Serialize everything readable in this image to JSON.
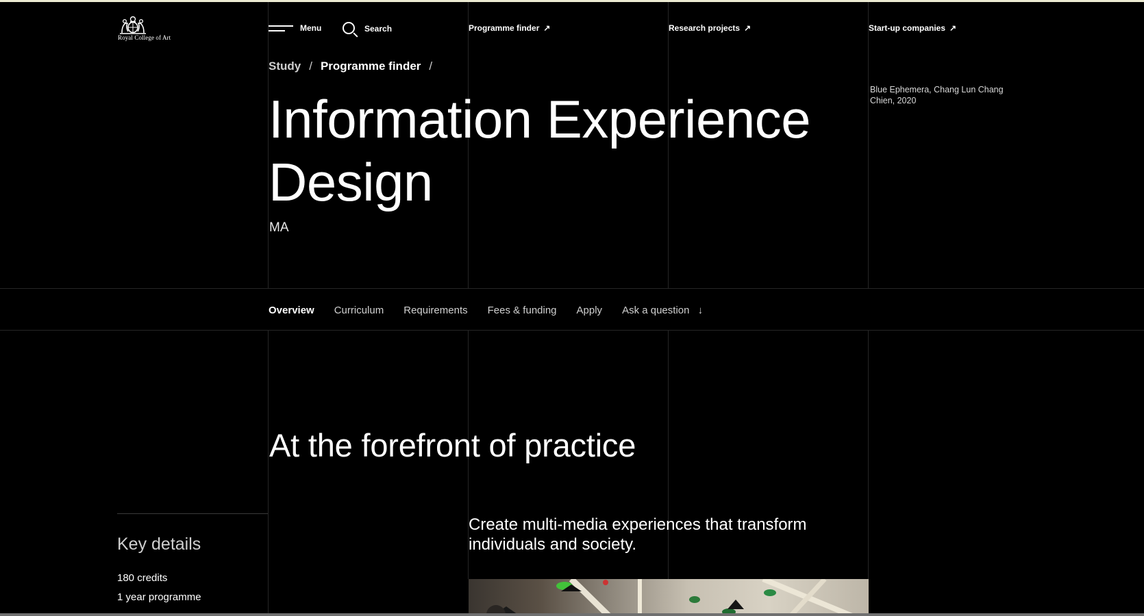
{
  "logo": {
    "text": "Royal College of Art"
  },
  "header": {
    "menu_label": "Menu",
    "search_label": "Search",
    "links": [
      {
        "label": "Programme finder",
        "icon": "external-arrow-icon"
      },
      {
        "label": "Research projects",
        "icon": "external-arrow-icon"
      },
      {
        "label": "Start-up companies",
        "icon": "external-arrow-icon"
      }
    ]
  },
  "breadcrumb": {
    "items": [
      "Study",
      "Programme finder"
    ],
    "separator": "/"
  },
  "hero": {
    "title": "Information Experience Design",
    "degree": "MA",
    "caption": "Blue Ephemera, Chang Lun Chang Chien, 2020"
  },
  "tabs": [
    {
      "label": "Overview",
      "active": true
    },
    {
      "label": "Curriculum"
    },
    {
      "label": "Requirements"
    },
    {
      "label": "Fees & funding"
    },
    {
      "label": "Apply"
    },
    {
      "label": "Ask a question",
      "icon": "arrow-down-icon"
    }
  ],
  "overview": {
    "heading": "At the forefront of practice",
    "intro": "Create multi-media experiences that transform individuals and society."
  },
  "key_details": {
    "title": "Key details",
    "items": [
      "180 credits",
      "1 year programme"
    ]
  },
  "colors": {
    "background": "#000000",
    "text": "#ffffff",
    "grid": "#262626",
    "top_accent": "#ecebd2"
  }
}
